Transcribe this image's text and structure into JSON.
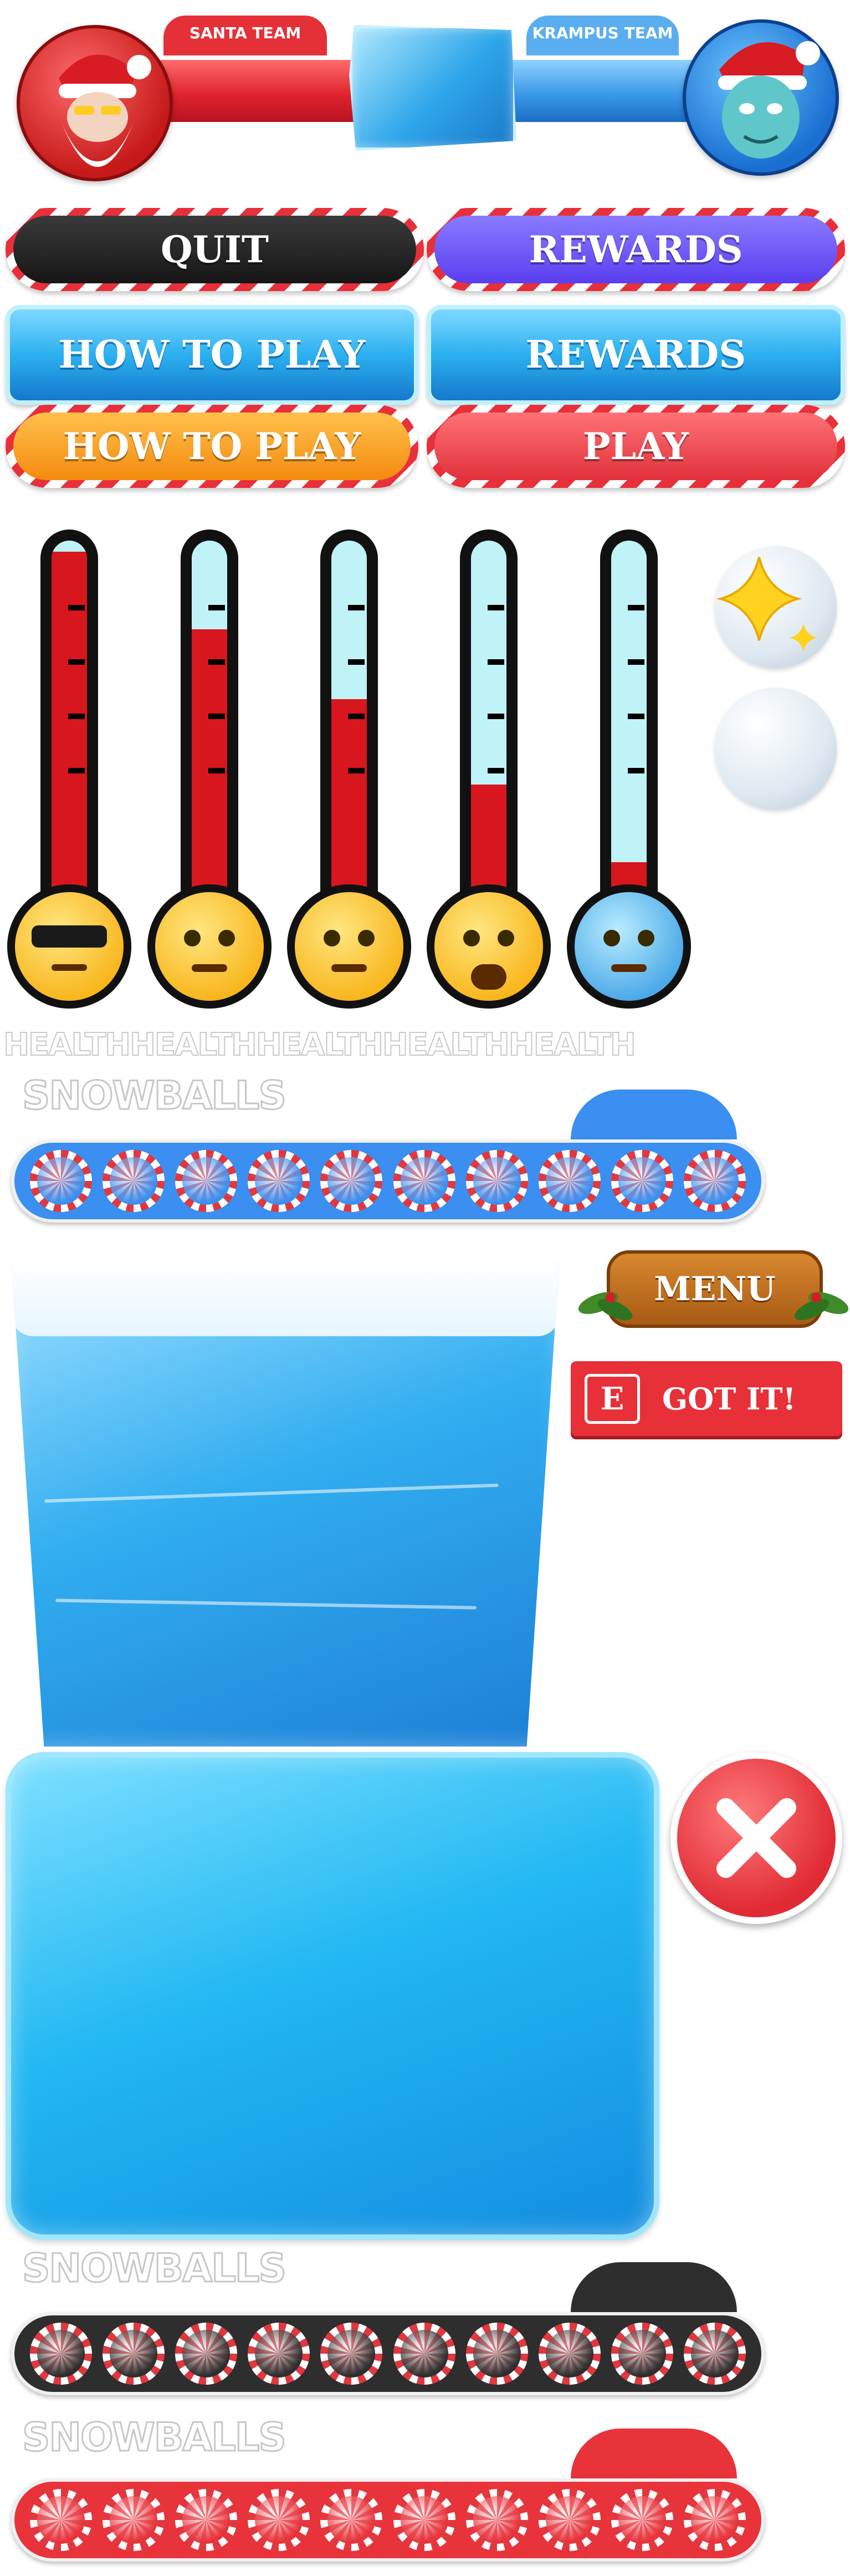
{
  "header": {
    "santa_team": "SANTA TEAM",
    "krampus_team": "KRAMPUS TEAM"
  },
  "buttons": {
    "quit": "QUIT",
    "rewards_purple": "REWARDS",
    "how_to_play_ice": "HOW TO PLAY",
    "rewards_ice": "REWARDS",
    "how_to_play_orange": "HOW TO PLAY",
    "play": "PLAY"
  },
  "thermometers": [
    {
      "level": 1.0,
      "emoji": "sunglasses-emoji"
    },
    {
      "level": 0.8,
      "emoji": "sweat-emoji"
    },
    {
      "level": 0.62,
      "emoji": "anxious-emoji"
    },
    {
      "level": 0.4,
      "emoji": "scream-emoji"
    },
    {
      "level": 0.2,
      "emoji": "cold-emoji"
    }
  ],
  "health_label": "HEALTHHEALTHHEALTHHEALTHHEALTH",
  "snowball_bars": [
    {
      "label": "SNOWBALLS",
      "color": "#3a8ff0"
    },
    {
      "label": "SNOWBALLS",
      "color": "#2e2e2e"
    },
    {
      "label": "SNOWBALLS",
      "color": "#e8333b"
    }
  ],
  "menu_label": "MENU",
  "got_it": {
    "key": "E",
    "label": "GOT IT!"
  },
  "colors": {
    "santa_red": "#e53038",
    "krampus_blue": "#5aaef0",
    "ice": "#2fa6ea"
  }
}
